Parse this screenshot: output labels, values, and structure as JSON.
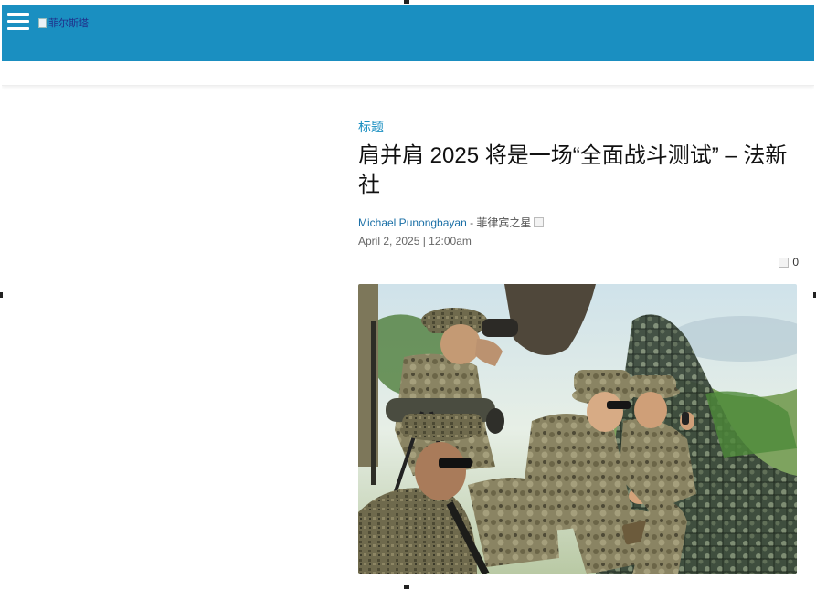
{
  "header": {
    "menu_icon": "hamburger-menu-icon",
    "logo_alt": "菲尔斯塔",
    "bar_color": "#1a8fc1"
  },
  "article": {
    "category": "标题",
    "title": "肩并肩 2025 将是一场“全面战斗测试” – 法新社",
    "author": "Michael Punongbayan",
    "source": " - 菲律宾之星",
    "date": "April 2, 2025 | 12:00am",
    "comment_count": "0",
    "accent_color": "#1a8fc1"
  }
}
